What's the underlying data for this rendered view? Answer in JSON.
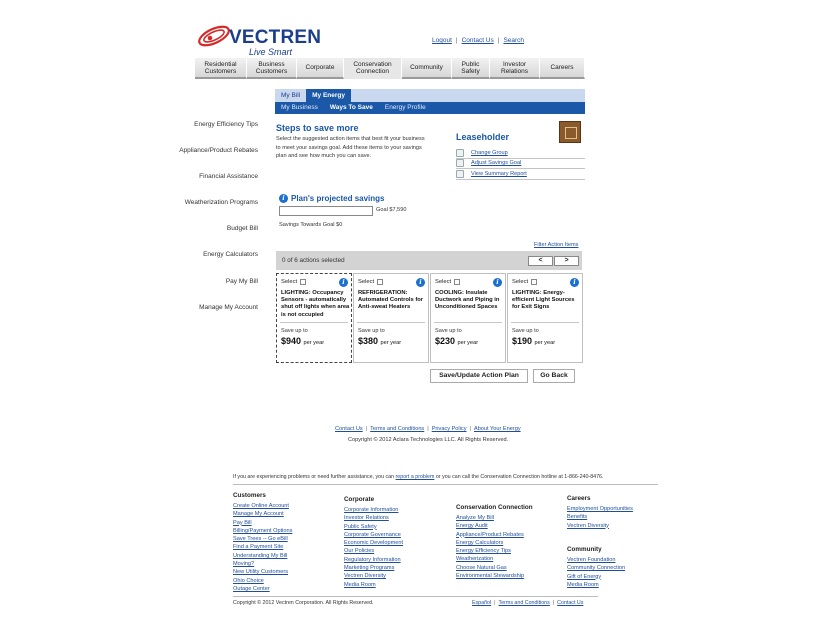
{
  "brand": {
    "name": "VECTREN",
    "tagline": "Live Smart"
  },
  "top_links": [
    "Logout",
    "Contact Us",
    "Search"
  ],
  "main_nav": [
    {
      "label": "Residential Customers",
      "active": false
    },
    {
      "label": "Business Customers",
      "active": false
    },
    {
      "label": "Corporate",
      "active": false
    },
    {
      "label": "Conservation Connection",
      "active": true
    },
    {
      "label": "Community",
      "active": false
    },
    {
      "label": "Public Safety",
      "active": false
    },
    {
      "label": "Investor Relations",
      "active": false
    },
    {
      "label": "Careers",
      "active": false
    }
  ],
  "sub_nav_1": [
    {
      "label": "My Bill",
      "active": false
    },
    {
      "label": "My Energy",
      "active": true
    }
  ],
  "sub_nav_2": [
    {
      "label": "My Business",
      "active": false
    },
    {
      "label": "Ways To Save",
      "active": true
    },
    {
      "label": "Energy Profile",
      "active": false
    }
  ],
  "left_nav": [
    "Energy Efficiency Tips",
    "Appliance/Product Rebates",
    "Financial Assistance",
    "Weatherization Programs",
    "Budget Bill",
    "Energy Calculators",
    "Pay My Bill",
    "Manage My Account"
  ],
  "steps": {
    "title": "Steps to save more",
    "desc_lines": [
      "Select the suggested action items that best fit your business",
      "to meet your savings goal. Add these items to your savings",
      "plan and see how much you can save."
    ]
  },
  "account": {
    "type": "Leaseholder",
    "links": [
      "Change Group",
      "Adjust Savings Goal",
      "View Summary Report"
    ]
  },
  "plan": {
    "title": "Plan's projected savings",
    "goal": "Goal $7,590",
    "towards": "Savings Towards Goal $0"
  },
  "filter_label": "Filter Action Items",
  "actions": {
    "count_text": "0 of 6 actions selected",
    "prev": "<",
    "next": ">",
    "select_label": "Select",
    "save_up_to": "Save up to",
    "per_year": "per year",
    "cards": [
      {
        "title": "LIGHTING: Occupancy Sensors - automatically shut off lights when area is not occupied",
        "amount": "$940",
        "highlighted": true
      },
      {
        "title": "REFRIGERATION: Automated Controls for Anti-sweat Heaters",
        "amount": "$380",
        "highlighted": false
      },
      {
        "title": "COOLING: Insulate Ductwork and Piping in Unconditioned Spaces",
        "amount": "$230",
        "highlighted": false
      },
      {
        "title": "LIGHTING: Energy-efficient Light Sources for Exit Signs",
        "amount": "$190",
        "highlighted": false
      }
    ]
  },
  "buttons": {
    "save": "Save/Update Action Plan",
    "back": "Go Back"
  },
  "footer": {
    "links": [
      "Contact Us",
      "Terms and Conditions",
      "Privacy Policy",
      "About Your Energy"
    ],
    "copyright_aclara": "Copyright © 2012 Aclara Technologies LLC. All Rights Reserved.",
    "help_pre": "If you are experiencing problems or need further assistance, you can",
    "help_link": "report a problem",
    "help_post": "or you can call the Conservation Connection hotline at 1-866-240-8476.",
    "columns": [
      {
        "heading": "Customers",
        "links": [
          "Create Online Account",
          "Manage My Account",
          "Pay Bill",
          "Billing/Payment Options",
          "Save Trees -- Go eBill",
          "Find a Payment Site",
          "Understanding My Bill",
          "Moving?",
          "New Utility Customers",
          "Ohio Choice",
          "Outage Center"
        ]
      },
      {
        "heading": "Corporate",
        "links": [
          "Corporate Information",
          "Investor Relations",
          "Public Safety",
          "Corporate Governance",
          "Economic Development",
          "Our Policies",
          "Regulatory Information",
          "Marketing Programs",
          "Vectren Diversity",
          "Media Room"
        ]
      },
      {
        "heading": "Conservation Connection",
        "links": [
          "Analyze My Bill",
          "Energy Audit",
          "Appliance/Product Rebates",
          "Energy Calculators",
          "Energy Efficiency Tips",
          "Weatherization",
          "Choose Natural Gas",
          "Environmental Stewardship"
        ]
      },
      {
        "heading": "Careers",
        "links": [
          "Employment Opportunities",
          "Benefits",
          "Vectren Diversity"
        ]
      },
      {
        "heading": "Community",
        "links": [
          "Vectren Foundation",
          "Community Connection",
          "Gift of Energy",
          "Media Room"
        ]
      }
    ],
    "copyright_vectren": "Copyright © 2012 Vectren Corporation. All Rights Reserved.",
    "bottom_links": [
      "Español",
      "Terms and Conditions",
      "Contact Us"
    ]
  },
  "colors": {
    "brand_blue": "#1b3f8c",
    "accent_blue": "#1b58a8",
    "logo_red": "#d62a2a",
    "link": "#1f4e9e"
  }
}
